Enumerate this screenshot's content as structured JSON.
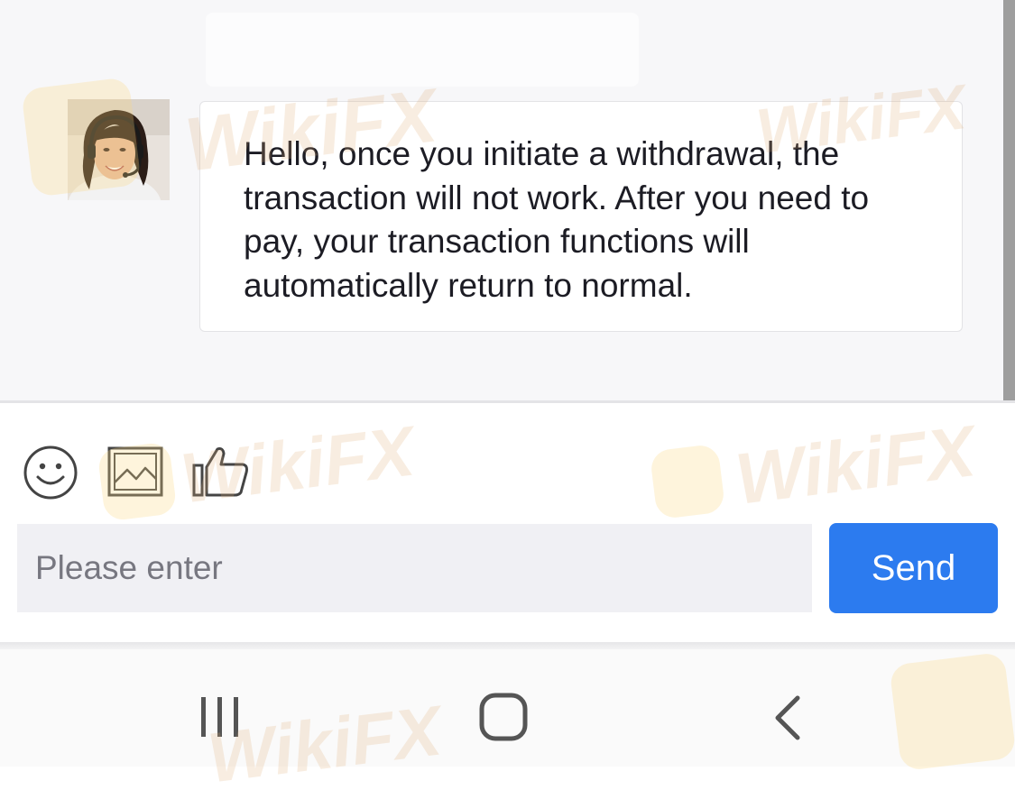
{
  "chat": {
    "incoming_message": {
      "sender": "agent",
      "avatar_icon": "agent-headset-avatar",
      "text": "Hello, once you initiate a withdrawal, the transaction will not work. After you need to pay, your transaction functions will automatically return to normal."
    }
  },
  "toolbar": {
    "icons": [
      "emoji-icon",
      "image-icon",
      "thumbs-up-icon"
    ]
  },
  "composer": {
    "placeholder": "Please enter",
    "value": "",
    "send_label": "Send"
  },
  "nav_bar": {
    "buttons": [
      "recents-icon",
      "home-icon",
      "back-icon"
    ]
  },
  "watermark": {
    "text": "WikiFX"
  },
  "colors": {
    "send_button": "#2c7bef",
    "chat_background": "#f7f7f9",
    "input_background": "#f0f0f4",
    "message_text": "#1c1c24"
  }
}
